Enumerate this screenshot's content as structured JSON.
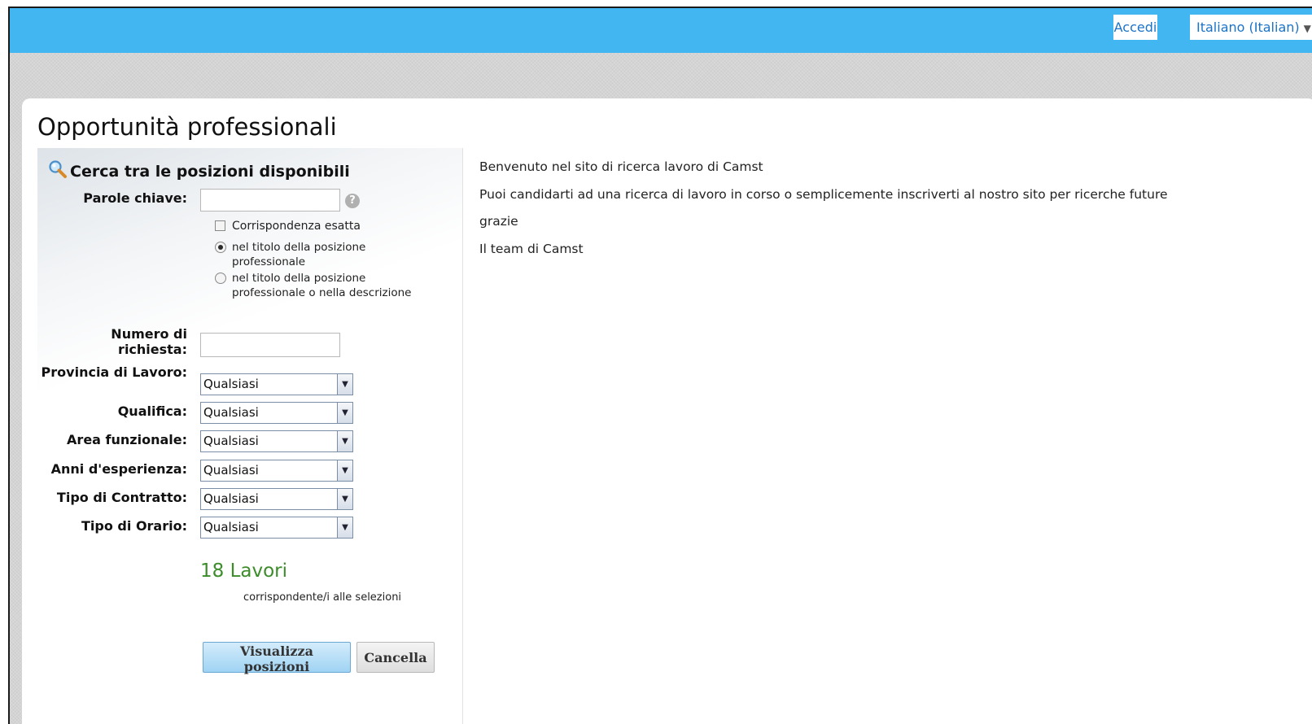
{
  "header": {
    "login_label": "Accedi",
    "language_label": "Italiano (Italian)"
  },
  "page": {
    "title": "Opportunità professionali"
  },
  "search": {
    "title": "Cerca tra le posizioni disponibili",
    "keywords_label": "Parole chiave:",
    "keywords_value": "",
    "help_glyph": "?",
    "exact_match_label": "Corrispondenza esatta",
    "exact_match_checked": false,
    "scope_options": [
      "nel titolo della posizione professionale",
      "nel titolo della posizione professionale o nella descrizione"
    ],
    "scope_selected": 0,
    "request_number_label": "Numero di richiesta:",
    "request_number_value": "",
    "filters": [
      {
        "label": "Provincia di Lavoro:",
        "value": "Qualsiasi"
      },
      {
        "label": "Qualifica:",
        "value": "Qualsiasi"
      },
      {
        "label": "Area funzionale:",
        "value": "Qualsiasi"
      },
      {
        "label": "Anni d'esperienza:",
        "value": "Qualsiasi"
      },
      {
        "label": "Tipo di Contratto:",
        "value": "Qualsiasi"
      },
      {
        "label": "Tipo di Orario:",
        "value": "Qualsiasi"
      }
    ],
    "results_count": "18 Lavori",
    "results_caption": "corrispondente/i alle selezioni",
    "view_button": "Visualizza posizioni",
    "cancel_button": "Cancella"
  },
  "welcome": {
    "lines": [
      "Benvenuto nel sito di ricerca lavoro di Camst",
      "Puoi candidarti ad una ricerca di lavoro in corso o semplicemente inscriverti al nostro sito per ricerche future",
      "grazie",
      "Il team di Camst"
    ]
  },
  "colors": {
    "topbar": "#41b6f0",
    "link": "#1a73c7",
    "results_count": "#3c8c2a"
  },
  "icons": {
    "search": "magnifier-icon",
    "help": "help-icon",
    "language_caret": "caret-down-icon",
    "select_arrow": "chevron-down-icon"
  }
}
